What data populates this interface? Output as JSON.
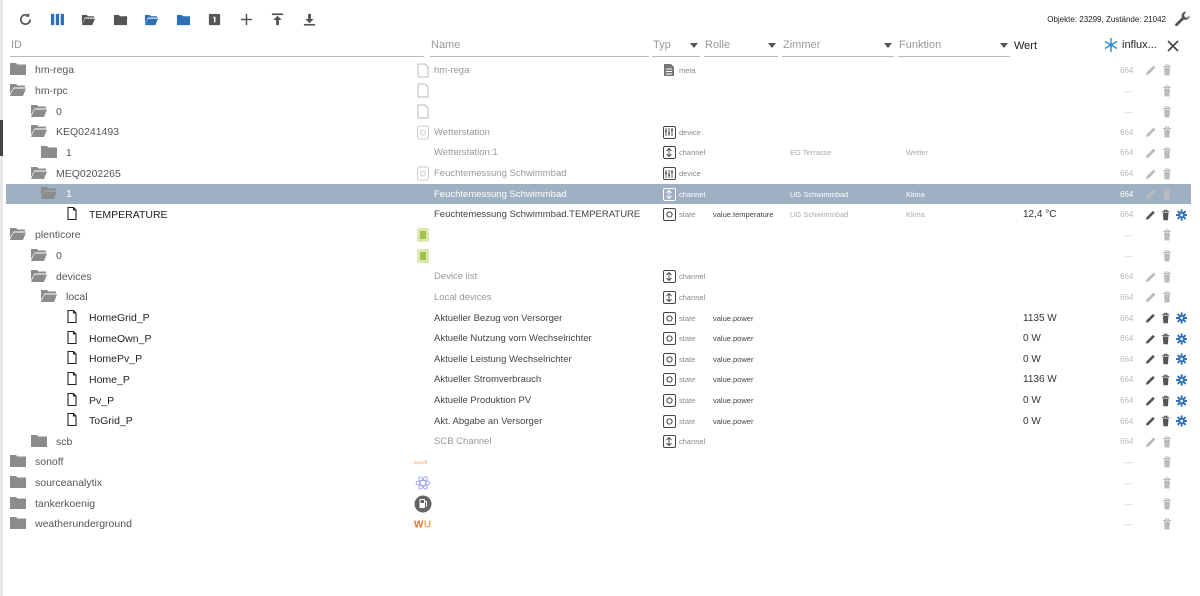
{
  "toolbar": {
    "stats": "Objekte: 23299, Zustände: 21042"
  },
  "header": {
    "id": "ID",
    "name": "Name",
    "type": "Typ",
    "role": "Rolle",
    "room": "Zimmer",
    "func": "Funktion",
    "value": "Wert",
    "influx": "influx..."
  },
  "colors": {
    "folder": "#8c8c8c",
    "folder_blue": "#4a7fb5",
    "accent": "#2d6fb8",
    "selected": "#9eb0c2"
  },
  "rows": [
    {
      "depth": 0,
      "icon": "folder",
      "id": "hm-rega",
      "nicon": "doc",
      "name": "hm-rega",
      "ticon": "meta",
      "type": "meta",
      "role": "",
      "room": "",
      "func": "",
      "value": "",
      "acl": "664",
      "actions": "edit-delete"
    },
    {
      "depth": 0,
      "icon": "folder-open",
      "id": "hm-rpc",
      "nicon": "doc",
      "name": "",
      "ticon": "",
      "type": "",
      "role": "",
      "room": "",
      "func": "",
      "value": "",
      "acl": "—",
      "actions": "delete"
    },
    {
      "depth": 1,
      "icon": "folder-open",
      "id": "0",
      "nicon": "doc",
      "name": "",
      "ticon": "",
      "type": "",
      "role": "",
      "room": "",
      "func": "",
      "value": "",
      "acl": "—",
      "actions": "delete"
    },
    {
      "depth": 1,
      "icon": "folder-open",
      "id": "KEQ0241493",
      "nicon": "device",
      "name": "Wetterstation",
      "ticon": "device",
      "type": "device",
      "role": "",
      "room": "",
      "func": "",
      "value": "",
      "acl": "664",
      "actions": "edit-delete"
    },
    {
      "depth": 2,
      "icon": "folder",
      "id": "1",
      "nicon": "",
      "name": "Wetterstation:1",
      "ticon": "channel",
      "type": "channel",
      "role": "",
      "room": "EG Terrasse",
      "func": "Wetter",
      "value": "",
      "acl": "664",
      "actions": "edit-delete"
    },
    {
      "depth": 1,
      "icon": "folder-open",
      "id": "MEQ0202265",
      "nicon": "device",
      "name": "Feuchtemessung Schwimmbad",
      "ticon": "device",
      "type": "device",
      "role": "",
      "room": "",
      "func": "",
      "value": "",
      "acl": "664",
      "actions": "edit-delete"
    },
    {
      "depth": 2,
      "icon": "folder-open",
      "id": "1",
      "nicon": "",
      "name": "Feuchtemessung Schwimmbad",
      "ticon": "channel",
      "type": "channel",
      "role": "",
      "room": "UG Schwimmbad",
      "func": "Klima",
      "value": "",
      "acl": "664",
      "actions": "edit-delete",
      "selected": true
    },
    {
      "depth": 3,
      "icon": "file",
      "id": "TEMPERATURE",
      "nicon": "",
      "name": "Feuchtemessung Schwimmbad.TEMPERATURE",
      "ticon": "state",
      "type": "state",
      "role": "value.temperature",
      "room": "UG Schwimmbad",
      "func": "Klima",
      "value": "12,4 °C",
      "acl": "664",
      "actions": "edit-delete-gear"
    },
    {
      "depth": 0,
      "icon": "folder-open",
      "id": "plenticore",
      "nicon": "green",
      "name": "",
      "ticon": "",
      "type": "",
      "role": "",
      "room": "",
      "func": "",
      "value": "",
      "acl": "—",
      "actions": "delete"
    },
    {
      "depth": 1,
      "icon": "folder-open",
      "id": "0",
      "nicon": "green",
      "name": "",
      "ticon": "",
      "type": "",
      "role": "",
      "room": "",
      "func": "",
      "value": "",
      "acl": "—",
      "actions": "delete"
    },
    {
      "depth": 1,
      "icon": "folder-open",
      "id": "devices",
      "nicon": "",
      "name": "Device list",
      "ticon": "channel",
      "type": "channel",
      "role": "",
      "room": "",
      "func": "",
      "value": "",
      "acl": "664",
      "actions": "edit-delete"
    },
    {
      "depth": 2,
      "icon": "folder-open",
      "id": "local",
      "nicon": "",
      "name": "Local devices",
      "ticon": "channel",
      "type": "channel",
      "role": "",
      "room": "",
      "func": "",
      "value": "",
      "acl": "664",
      "actions": "edit-delete"
    },
    {
      "depth": 3,
      "icon": "file",
      "id": "HomeGrid_P",
      "nicon": "",
      "name": "Aktueller Bezug von Versorger",
      "ticon": "state",
      "type": "state",
      "role": "value.power",
      "room": "",
      "func": "",
      "value": "1135 W",
      "acl": "664",
      "actions": "edit-delete-gear"
    },
    {
      "depth": 3,
      "icon": "file",
      "id": "HomeOwn_P",
      "nicon": "",
      "name": "Aktuelle Nutzung vom Wechselrichter",
      "ticon": "state",
      "type": "state",
      "role": "value.power",
      "room": "",
      "func": "",
      "value": "0 W",
      "acl": "664",
      "actions": "edit-delete-gear"
    },
    {
      "depth": 3,
      "icon": "file",
      "id": "HomePv_P",
      "nicon": "",
      "name": "Aktuelle Leistung Wechselrichter",
      "ticon": "state",
      "type": "state",
      "role": "value.power",
      "room": "",
      "func": "",
      "value": "0 W",
      "acl": "664",
      "actions": "edit-delete-gear"
    },
    {
      "depth": 3,
      "icon": "file",
      "id": "Home_P",
      "nicon": "",
      "name": "Aktueller Stromverbrauch",
      "ticon": "state",
      "type": "state",
      "role": "value.power",
      "room": "",
      "func": "",
      "value": "1136 W",
      "acl": "664",
      "actions": "edit-delete-gear"
    },
    {
      "depth": 3,
      "icon": "file",
      "id": "Pv_P",
      "nicon": "",
      "name": "Aktuelle Produktion PV",
      "ticon": "state",
      "type": "state",
      "role": "value.power",
      "room": "",
      "func": "",
      "value": "0 W",
      "acl": "664",
      "actions": "edit-delete-gear"
    },
    {
      "depth": 3,
      "icon": "file",
      "id": "ToGrid_P",
      "nicon": "",
      "name": "Akt. Abgabe an Versorger",
      "ticon": "state",
      "type": "state",
      "role": "value.power",
      "room": "",
      "func": "",
      "value": "0 W",
      "acl": "664",
      "actions": "edit-delete-gear"
    },
    {
      "depth": 1,
      "icon": "folder",
      "id": "scb",
      "nicon": "",
      "name": "SCB Channel",
      "ticon": "channel",
      "type": "channel",
      "role": "",
      "room": "",
      "func": "",
      "value": "",
      "acl": "664",
      "actions": "edit-delete"
    },
    {
      "depth": 0,
      "icon": "folder",
      "id": "sonoff",
      "nicon": "sonoff",
      "name": "",
      "ticon": "",
      "type": "",
      "role": "",
      "room": "",
      "func": "",
      "value": "",
      "acl": "—",
      "actions": "delete"
    },
    {
      "depth": 0,
      "icon": "folder",
      "id": "sourceanalytix",
      "nicon": "atom",
      "name": "",
      "ticon": "",
      "type": "",
      "role": "",
      "room": "",
      "func": "",
      "value": "",
      "acl": "—",
      "actions": "delete"
    },
    {
      "depth": 0,
      "icon": "folder",
      "id": "tankerkoenig",
      "nicon": "fuel",
      "name": "",
      "ticon": "",
      "type": "",
      "role": "",
      "room": "",
      "func": "",
      "value": "",
      "acl": "—",
      "actions": "delete"
    },
    {
      "depth": 0,
      "icon": "folder",
      "id": "weatherunderground",
      "nicon": "wu",
      "name": "",
      "ticon": "",
      "type": "",
      "role": "",
      "room": "",
      "func": "",
      "value": "",
      "acl": "—",
      "actions": "delete"
    }
  ]
}
